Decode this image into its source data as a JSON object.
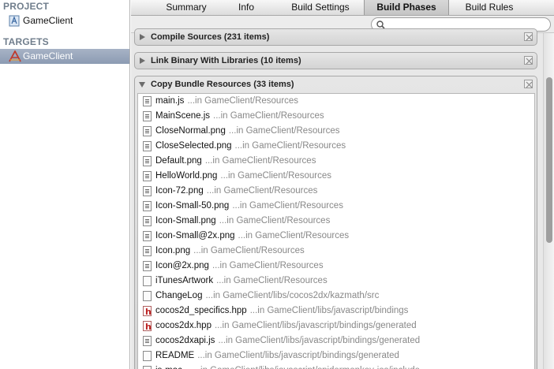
{
  "sidebar": {
    "project_header": "PROJECT",
    "project_item": "GameClient",
    "targets_header": "TARGETS",
    "target_item": "GameClient"
  },
  "tabs": [
    "Summary",
    "Info",
    "Build Settings",
    "Build Phases",
    "Build Rules"
  ],
  "active_tab": "Build Phases",
  "search": {
    "value": "",
    "placeholder": ""
  },
  "phases": {
    "compile": {
      "title": "Compile Sources (231 items)"
    },
    "link": {
      "title": "Link Binary With Libraries (10 items)"
    },
    "copy": {
      "title": "Copy Bundle Resources (33 items)"
    }
  },
  "resources": [
    {
      "name": "main.js",
      "location": "...in GameClient/Resources",
      "icon": "js-file-icon"
    },
    {
      "name": "MainScene.js",
      "location": "...in GameClient/Resources",
      "icon": "js-file-icon"
    },
    {
      "name": "CloseNormal.png",
      "location": "...in GameClient/Resources",
      "icon": "png-file-icon"
    },
    {
      "name": "CloseSelected.png",
      "location": "...in GameClient/Resources",
      "icon": "png-file-icon"
    },
    {
      "name": "Default.png",
      "location": "...in GameClient/Resources",
      "icon": "png-file-icon"
    },
    {
      "name": "HelloWorld.png",
      "location": "...in GameClient/Resources",
      "icon": "png-file-icon"
    },
    {
      "name": "Icon-72.png",
      "location": "...in GameClient/Resources",
      "icon": "png-file-icon"
    },
    {
      "name": "Icon-Small-50.png",
      "location": "...in GameClient/Resources",
      "icon": "png-file-icon"
    },
    {
      "name": "Icon-Small.png",
      "location": "...in GameClient/Resources",
      "icon": "png-file-icon"
    },
    {
      "name": "Icon-Small@2x.png",
      "location": "...in GameClient/Resources",
      "icon": "png-file-icon"
    },
    {
      "name": "Icon.png",
      "location": "...in GameClient/Resources",
      "icon": "png-file-icon"
    },
    {
      "name": "Icon@2x.png",
      "location": "...in GameClient/Resources",
      "icon": "png-file-icon"
    },
    {
      "name": "iTunesArtwork",
      "location": "...in GameClient/Resources",
      "icon": "blank-file-icon"
    },
    {
      "name": "ChangeLog",
      "location": "...in GameClient/libs/cocos2dx/kazmath/src",
      "icon": "blank-file-icon"
    },
    {
      "name": "cocos2d_specifics.hpp",
      "location": "...in GameClient/libs/javascript/bindings",
      "icon": "header-file-icon"
    },
    {
      "name": "cocos2dx.hpp",
      "location": "...in GameClient/libs/javascript/bindings/generated",
      "icon": "header-file-icon"
    },
    {
      "name": "cocos2dxapi.js",
      "location": "...in GameClient/libs/javascript/bindings/generated",
      "icon": "js-file-icon"
    },
    {
      "name": "README",
      "location": "...in GameClient/libs/javascript/bindings/generated",
      "icon": "blank-file-icon"
    },
    {
      "name": "js-mac...",
      "location": "...in GameClient/libs/javascript/spidermonkey-ios/include",
      "icon": "blank-file-icon"
    }
  ],
  "colors": {
    "selection": "#8c9bb3",
    "sidebar_header": "#707e8c",
    "location_text": "#888888"
  }
}
